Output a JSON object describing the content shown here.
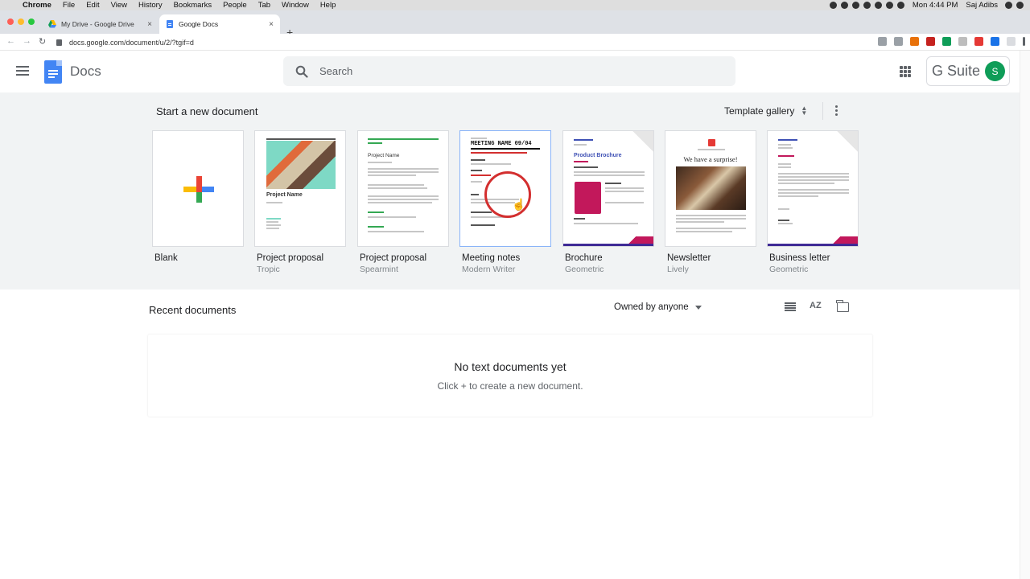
{
  "macos_menubar": {
    "apple": "",
    "app": "Chrome",
    "menus": [
      "File",
      "Edit",
      "View",
      "History",
      "Bookmarks",
      "People",
      "Tab",
      "Window",
      "Help"
    ],
    "clock": "Mon 4:44 PM",
    "user": "Saj Adibs"
  },
  "browser": {
    "tabs": [
      {
        "title": "My Drive - Google Drive",
        "close": "×"
      },
      {
        "title": "Google Docs",
        "close": "×"
      }
    ],
    "new_tab": "+",
    "back": "←",
    "forward": "→",
    "reload": "↻",
    "url": "docs.google.com/document/u/2/?tgif=d"
  },
  "header": {
    "app_name": "Docs",
    "search_placeholder": "Search",
    "gsuite_label": "G Suite",
    "avatar_initial": "S"
  },
  "templates_section": {
    "title": "Start a new document",
    "gallery_label": "Template gallery",
    "items": [
      {
        "name": "Blank",
        "subtitle": ""
      },
      {
        "name": "Project proposal",
        "subtitle": "Tropic",
        "thumb_heading": "Project Name"
      },
      {
        "name": "Project proposal",
        "subtitle": "Spearmint",
        "thumb_heading": "Project Name"
      },
      {
        "name": "Meeting notes",
        "subtitle": "Modern Writer",
        "thumb_heading": "MEETING NAME 09/04"
      },
      {
        "name": "Brochure",
        "subtitle": "Geometric",
        "thumb_heading": "Product Brochure"
      },
      {
        "name": "Newsletter",
        "subtitle": "Lively",
        "thumb_heading": "We have a surprise!"
      },
      {
        "name": "Business letter",
        "subtitle": "Geometric"
      }
    ]
  },
  "recent": {
    "title": "Recent documents",
    "owner_filter": "Owned by anyone",
    "sort_icon_text": "AZ",
    "empty_title": "No text documents yet",
    "empty_subtitle": "Click + to create a new document."
  },
  "colors": {
    "accent_blue": "#4285f4",
    "template_bg": "#f1f3f4",
    "avatar_green": "#0f9d58"
  }
}
